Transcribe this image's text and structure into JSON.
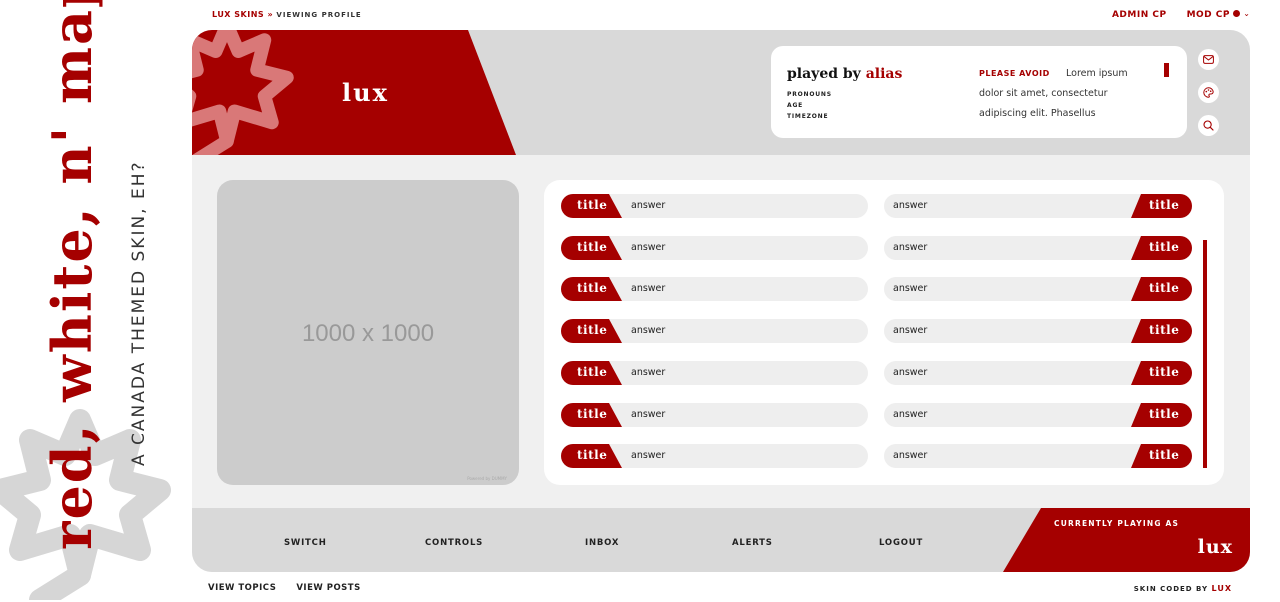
{
  "side": {
    "title": "red, white, n' maple",
    "subtitle": "A CANADA THEMED SKIN, EH?"
  },
  "topbar": {
    "home": "LUX SKINS",
    "separator": "»",
    "crumb": "VIEWING PROFILE",
    "admin": "ADMIN CP",
    "mod": "MOD CP",
    "icons": [
      "chevron-up-icon",
      "dot-icon",
      "chevron-down-icon"
    ]
  },
  "profile": {
    "name": "lux",
    "played_by_prefix": "played by",
    "alias": "alias",
    "pronouns_label": "PRONOUNS",
    "age_label": "AGE",
    "timezone_label": "TIMEZONE",
    "avoid_label": "PLEASE AVOID",
    "avoid_line1": "Lorem ipsum",
    "avoid_line2": "dolor sit amet, consectetur",
    "avoid_line3": "adipiscing elit. Phasellus",
    "header_icons": [
      "mail-icon",
      "palette-icon",
      "search-icon"
    ]
  },
  "photo": {
    "label": "1000 x 1000",
    "credit": "Powered by DUMMY"
  },
  "fields": {
    "rows": [
      {
        "left_title": "title",
        "left_answer": "answer",
        "right_answer": "answer",
        "right_title": "title"
      },
      {
        "left_title": "title",
        "left_answer": "answer",
        "right_answer": "answer",
        "right_title": "title"
      },
      {
        "left_title": "title",
        "left_answer": "answer",
        "right_answer": "answer",
        "right_title": "title"
      },
      {
        "left_title": "title",
        "left_answer": "answer",
        "right_answer": "answer",
        "right_title": "title"
      },
      {
        "left_title": "title",
        "left_answer": "answer",
        "right_answer": "answer",
        "right_title": "title"
      },
      {
        "left_title": "title",
        "left_answer": "answer",
        "right_answer": "answer",
        "right_title": "title"
      },
      {
        "left_title": "title",
        "left_answer": "answer",
        "right_answer": "answer",
        "right_title": "title"
      }
    ]
  },
  "footer": {
    "nav": [
      "SWITCH",
      "CONTROLS",
      "INBOX",
      "ALERTS",
      "LOGOUT"
    ],
    "current_label": "CURRENTLY PLAYING AS",
    "current_name": "lux"
  },
  "bottom": {
    "view_topics": "VIEW TOPICS",
    "view_posts": "VIEW POSTS",
    "credit_prefix": "SKIN CODED BY",
    "credit_name": "LUX"
  },
  "colors": {
    "accent": "#a50000",
    "header_gray": "#d9d9d9",
    "body_gray": "#f0f0f0",
    "placeholder_gray": "#cccccc"
  }
}
